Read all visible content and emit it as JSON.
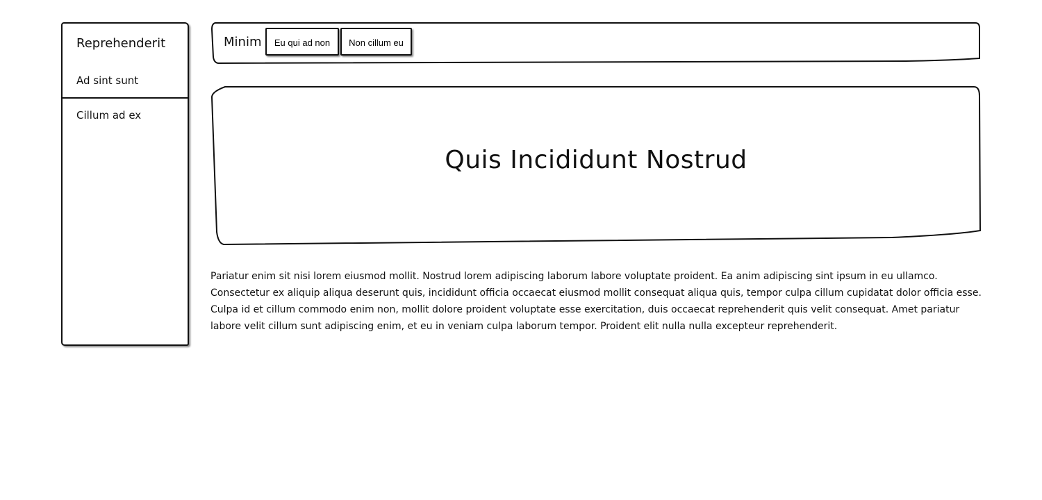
{
  "sidebar": {
    "title": "Reprehenderit",
    "items": [
      {
        "label": "Ad sint sunt"
      },
      {
        "label": "Cillum ad ex"
      }
    ]
  },
  "navbar": {
    "brand": "Minim",
    "buttons": [
      {
        "label": "Eu qui ad non"
      },
      {
        "label": "Non cillum eu"
      }
    ]
  },
  "hero": {
    "title": "Quis Incididunt Nostrud"
  },
  "content": {
    "paragraph": "Pariatur enim sit nisi lorem eiusmod mollit. Nostrud lorem adipiscing laborum labore voluptate proident. Ea anim adipiscing sint ipsum in eu ullamco. Consectetur ex aliquip aliqua deserunt quis, incididunt officia occaecat eiusmod mollit consequat aliqua quis, tempor culpa cillum cupidatat dolor officia esse. Culpa id et cillum commodo enim non, mollit dolore proident voluptate esse exercitation, duis occaecat reprehenderit quis velit consequat. Amet pariatur labore velit cillum sunt adipiscing enim, et eu in veniam culpa laborum tempor. Proident elit nulla nulla excepteur reprehenderit."
  }
}
